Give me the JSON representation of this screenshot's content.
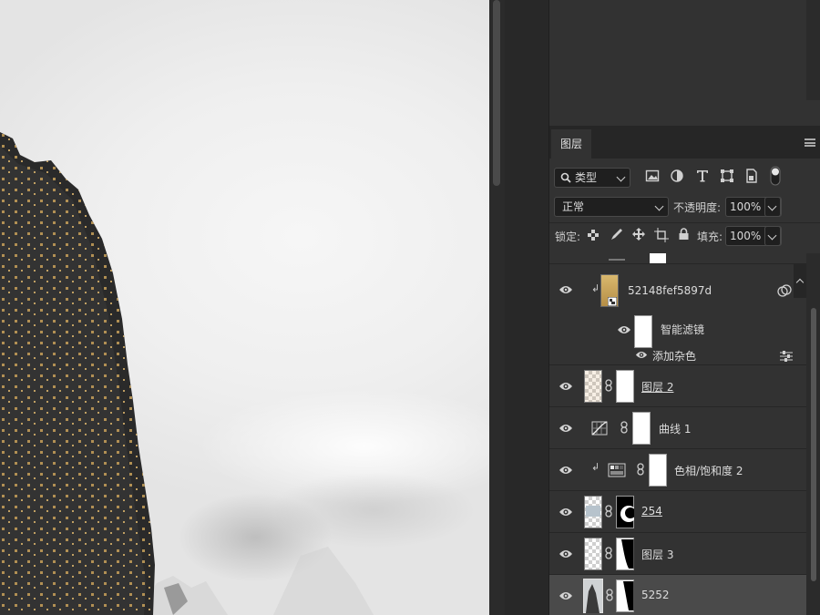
{
  "layers_panel": {
    "tab_label": "图层",
    "filter": {
      "kind_label": "类型"
    },
    "blend_mode": "正常",
    "opacity_label": "不透明度:",
    "opacity_value": "100%",
    "lock_label": "锁定:",
    "fill_label": "填充:",
    "fill_value": "100%",
    "layers": [
      {
        "name": "52148fef5897d",
        "type": "smart-object",
        "clipped": true,
        "visible": true,
        "smart_filter_label": "智能滤镜",
        "filter_name": "添加杂色"
      },
      {
        "name": "图层 2",
        "type": "pixel",
        "visible": true
      },
      {
        "name": "曲线 1",
        "type": "curves-adjustment",
        "visible": true
      },
      {
        "name": "色相/饱和度 2",
        "type": "hue-saturation-adjustment",
        "clipped": true,
        "visible": true
      },
      {
        "name": "254",
        "type": "pixel",
        "visible": true
      },
      {
        "name": "图层 3",
        "type": "pixel",
        "visible": true
      },
      {
        "name": "5252",
        "type": "pixel",
        "visible": true,
        "selected": true
      }
    ]
  },
  "colors": {
    "panel_bg": "#323232",
    "selected_row": "#4a4a4a",
    "accent_gold": "#c8a15a"
  }
}
